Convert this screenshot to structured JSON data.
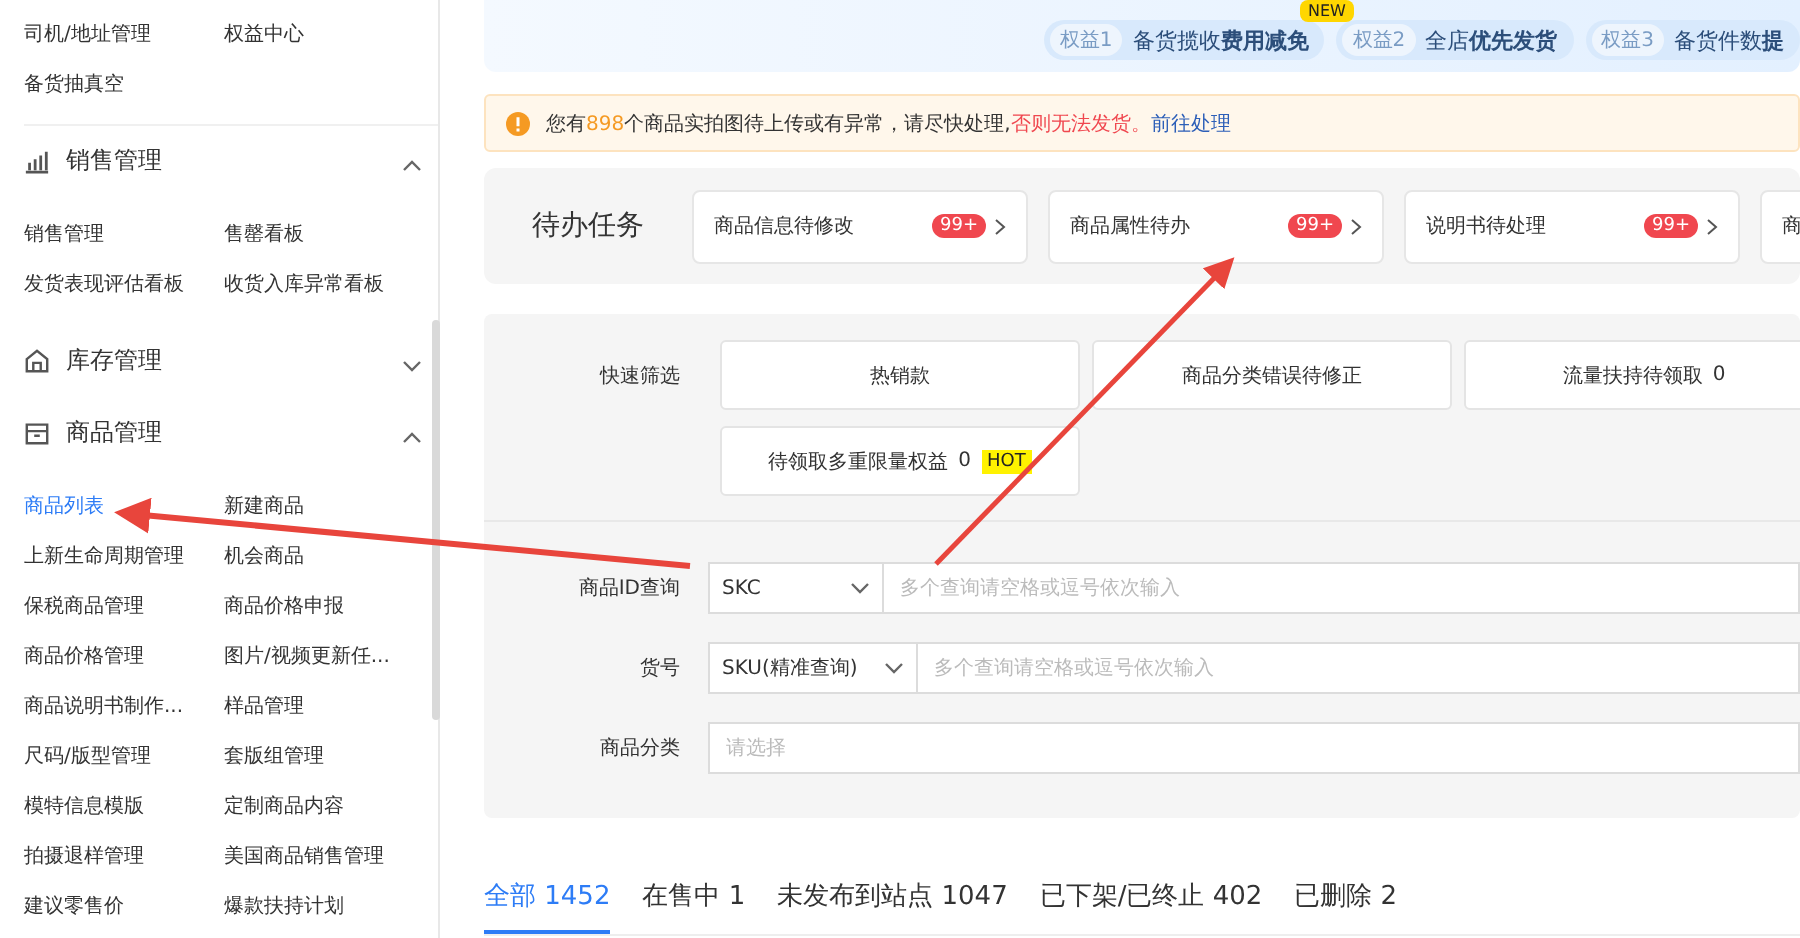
{
  "sidebar": {
    "top_items": [
      {
        "label": "司机/地址管理",
        "selected": false
      },
      {
        "label": "权益中心",
        "selected": false
      },
      {
        "label": "备货抽真空",
        "selected": false
      }
    ],
    "groups": [
      {
        "title": "销售管理",
        "expanded": true,
        "items": [
          {
            "label": "销售管理",
            "selected": false
          },
          {
            "label": "售罄看板",
            "selected": false
          },
          {
            "label": "发货表现评估看板",
            "selected": false
          },
          {
            "label": "收货入库异常看板",
            "selected": false
          }
        ]
      },
      {
        "title": "库存管理",
        "expanded": false
      },
      {
        "title": "商品管理",
        "expanded": true,
        "items": [
          {
            "label": "商品列表",
            "selected": true
          },
          {
            "label": "新建商品",
            "selected": false
          },
          {
            "label": "上新生命周期管理",
            "selected": false
          },
          {
            "label": "机会商品",
            "selected": false
          },
          {
            "label": "保税商品管理",
            "selected": false
          },
          {
            "label": "商品价格申报",
            "selected": false
          },
          {
            "label": "商品价格管理",
            "selected": false
          },
          {
            "label": "图片/视频更新任...",
            "selected": false
          },
          {
            "label": "商品说明书制作...",
            "selected": false
          },
          {
            "label": "样品管理",
            "selected": false
          },
          {
            "label": "尺码/版型管理",
            "selected": false
          },
          {
            "label": "套版组管理",
            "selected": false
          },
          {
            "label": "模特信息模版",
            "selected": false
          },
          {
            "label": "定制商品内容",
            "selected": false
          },
          {
            "label": "拍摄退样管理",
            "selected": false
          },
          {
            "label": "美国商品销售管理",
            "selected": false
          },
          {
            "label": "建议零售价",
            "selected": false
          },
          {
            "label": "爆款扶持计划",
            "selected": false
          }
        ]
      }
    ]
  },
  "banner": {
    "badge": "NEW",
    "benefits": [
      {
        "tag": "权益1",
        "text": "备货揽收**费用减免**"
      },
      {
        "tag": "权益2",
        "text": "全店**优先发货**"
      },
      {
        "tag": "权益3",
        "text": "备货件数**提**"
      }
    ]
  },
  "notice": {
    "before": "您有",
    "count": "898",
    "after": "个商品实拍图待上传或有异常，请尽快处理,",
    "warning": "否则无法发货。",
    "link": "前往处理"
  },
  "todo": {
    "title": "待办任务",
    "tasks": [
      {
        "label": "商品信息待修改",
        "count": "99+"
      },
      {
        "label": "商品属性待办",
        "count": "99+"
      },
      {
        "label": "说明书待处理",
        "count": "99+"
      },
      {
        "label": "商"
      }
    ]
  },
  "filters": {
    "quick_label": "快速筛选",
    "quick": [
      {
        "label": "热销款"
      },
      {
        "label": "商品分类错误待修正"
      },
      {
        "label": "流量扶持待领取",
        "count": "0"
      },
      {
        "label": "待领取多重限量权益",
        "count": "0",
        "hot": "HOT"
      }
    ],
    "fields": [
      {
        "kind": "select-input",
        "label": "商品ID查询",
        "select": "SKC",
        "placeholder": "多个查询请空格或逗号依次输入"
      },
      {
        "kind": "select-input",
        "label": "货号",
        "select": "SKU(精准查询)",
        "placeholder": "多个查询请空格或逗号依次输入"
      },
      {
        "kind": "input",
        "label": "商品分类",
        "placeholder": "请选择"
      }
    ]
  },
  "tabs": [
    {
      "label": "全部 1452",
      "selected": true
    },
    {
      "label": "在售中 1",
      "selected": false
    },
    {
      "label": "未发布到站点 1047",
      "selected": false
    },
    {
      "label": "已下架/已终止 402",
      "selected": false
    },
    {
      "label": "已删除 2",
      "selected": false
    }
  ]
}
